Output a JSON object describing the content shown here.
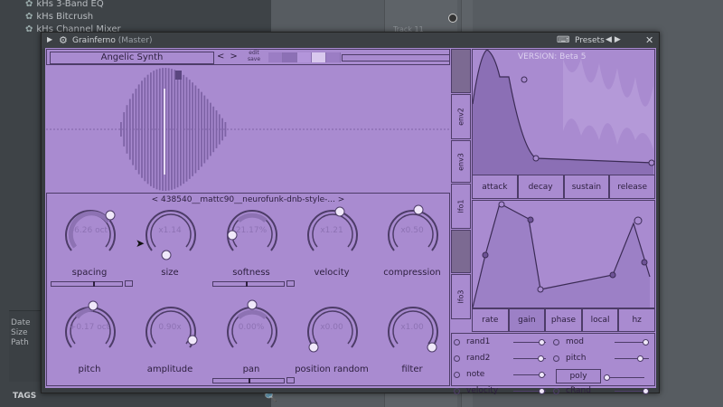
{
  "background": {
    "browser_items": [
      "kHs 3-Band EQ",
      "kHs Bitcrush",
      "kHs Channel Mixer"
    ],
    "track_label": "Track 11",
    "meta_fields": [
      "Date",
      "Size",
      "Path"
    ],
    "tags_label": "TAGS"
  },
  "window": {
    "title": "Grainferno",
    "title_sub": "(Master)",
    "presets_label": "Presets",
    "nav_prev": "◀",
    "nav_next": "▶",
    "close": "✕",
    "keyboard_icon": "keyboard-icon"
  },
  "header": {
    "preset_name": "Angelic Synth",
    "prev": "<",
    "next": ">",
    "edit_label": "edit",
    "save_label": "save"
  },
  "waveform": {
    "file_label": "< 438540__mattc90__neurofunk-dnb-style-... >"
  },
  "knobs_row1": [
    {
      "label": "spacing",
      "value": "-6.26 oct"
    },
    {
      "label": "size",
      "value": "x1.14"
    },
    {
      "label": "softness",
      "value": "21.17%"
    },
    {
      "label": "velocity",
      "value": "x1.21"
    },
    {
      "label": "compression",
      "value": "x0.50"
    }
  ],
  "knobs_row2": [
    {
      "label": "pitch",
      "value": "+0.17 oct"
    },
    {
      "label": "amplitude",
      "value": "0.90x"
    },
    {
      "label": "pan",
      "value": "0.00%"
    },
    {
      "label": "position random",
      "value": "x0.00"
    },
    {
      "label": "filter",
      "value": "x1.00"
    }
  ],
  "side_tabs": [
    "env2",
    "env3",
    "lfo1",
    "lfo3"
  ],
  "envelope": {
    "version": "VERSION: Beta 5",
    "buttons": [
      "attack",
      "decay",
      "sustain",
      "release"
    ]
  },
  "lfo": {
    "buttons": [
      "rate",
      "gain",
      "phase",
      "local",
      "hz"
    ]
  },
  "mod_sources": {
    "left": [
      "rand1",
      "rand2",
      "note",
      "velocity"
    ],
    "right": [
      "mod",
      "pitch",
      "cRand"
    ],
    "poly_label": "poly"
  },
  "colors": {
    "plugin_bg": "#a98bd0",
    "dark_line": "#4d3c68",
    "wave_bar": "#7e63a6"
  }
}
